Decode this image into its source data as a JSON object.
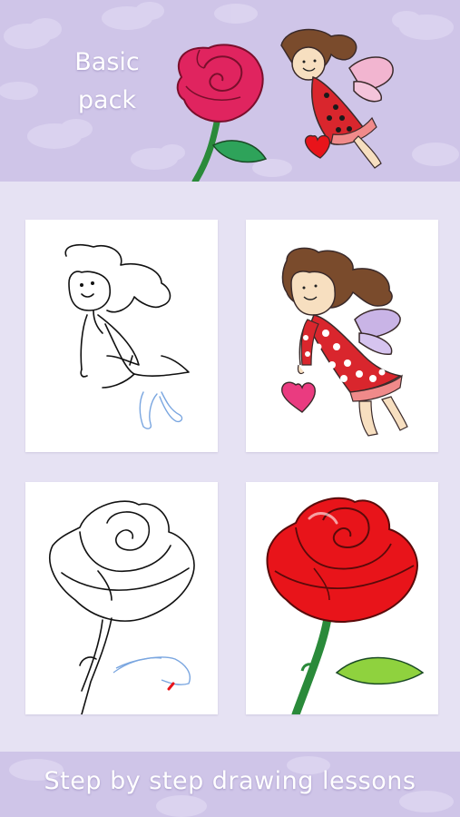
{
  "header": {
    "title_line1": "Basic",
    "title_line2": "pack",
    "art_rose_icon": "rose-illustration",
    "art_fairy_icon": "fairy-illustration"
  },
  "lessons": [
    {
      "name": "fairy",
      "stage": "sketch"
    },
    {
      "name": "fairy",
      "stage": "colored"
    },
    {
      "name": "rose",
      "stage": "sketch"
    },
    {
      "name": "rose",
      "stage": "colored"
    }
  ],
  "footer": {
    "tagline": "Step by step drawing lessons"
  },
  "colors": {
    "background": "#e6e2f3",
    "banner": "#cfc5e8",
    "rose_red": "#e8141a",
    "rose_pink": "#e0245f",
    "leaf_green": "#8fd23e",
    "dress_red": "#d9262d",
    "hair_brown": "#7a4b2c",
    "wing_lilac": "#c9b4e6"
  }
}
